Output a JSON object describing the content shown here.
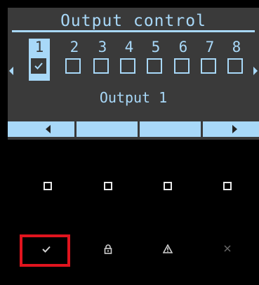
{
  "screen": {
    "title": "Output control",
    "outputs": [
      {
        "num": "1",
        "checked": true,
        "selected": true
      },
      {
        "num": "2",
        "checked": false,
        "selected": false
      },
      {
        "num": "3",
        "checked": false,
        "selected": false
      },
      {
        "num": "4",
        "checked": false,
        "selected": false
      },
      {
        "num": "5",
        "checked": false,
        "selected": false
      },
      {
        "num": "6",
        "checked": false,
        "selected": false
      },
      {
        "num": "7",
        "checked": false,
        "selected": false
      },
      {
        "num": "8",
        "checked": false,
        "selected": false
      }
    ],
    "selected_label": "Output 1"
  },
  "colors": {
    "accent": "#a8d8f8",
    "screen_bg": "#3a3a3a",
    "highlight": "#e0141e"
  },
  "softkeys": [
    "square-icon",
    "square-icon",
    "square-icon",
    "square-icon"
  ],
  "bottom_keys": [
    "check-icon",
    "lock-icon",
    "warning-icon",
    "close-icon"
  ]
}
